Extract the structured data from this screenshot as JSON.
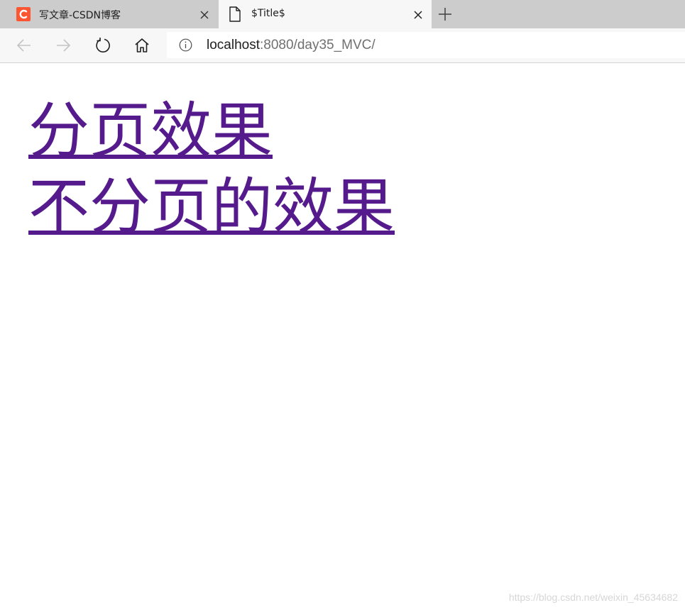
{
  "browser": {
    "tabs": [
      {
        "title": "写文章-CSDN博客",
        "active": false,
        "favicon": "csdn-logo-icon"
      },
      {
        "title": "$Title$",
        "active": true,
        "favicon": "document-icon"
      }
    ],
    "address": {
      "host": "localhost",
      "path": ":8080/day35_MVC/"
    },
    "colors": {
      "tabstrip": "#cccccc",
      "active_tab": "#f7f7f7",
      "csdn_brand": "#fc5531",
      "visited_link": "#551a8b"
    }
  },
  "page": {
    "links": [
      {
        "label": "分页效果"
      },
      {
        "label": "不分页的效果"
      }
    ]
  },
  "watermark": "https://blog.csdn.net/weixin_45634682"
}
